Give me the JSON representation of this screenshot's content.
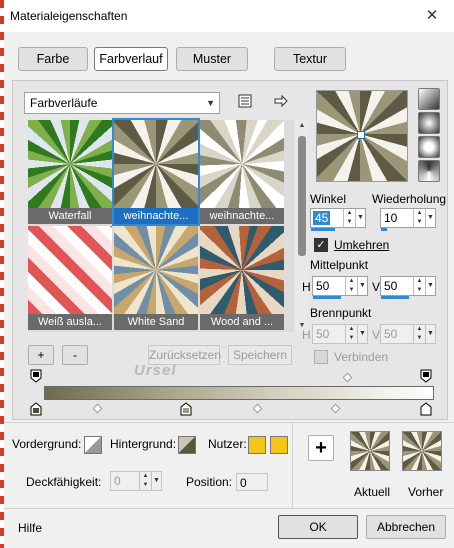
{
  "window": {
    "title": "Materialeigenschaften",
    "close_glyph": "✕"
  },
  "tabs": [
    "Farbe",
    "Farbverlauf",
    "Muster",
    "Textur"
  ],
  "active_tab": "Farbverlauf",
  "gradient_category": "Farbverläufe",
  "gradients": [
    {
      "label": "Waterfall",
      "selected": false
    },
    {
      "label": "weihnachte...",
      "selected": true
    },
    {
      "label": "weihnachte...",
      "selected": false
    },
    {
      "label": "Weiß ausla...",
      "selected": false
    },
    {
      "label": "White Sand",
      "selected": false
    },
    {
      "label": "Wood and ...",
      "selected": false
    }
  ],
  "angle": {
    "label": "Winkel",
    "value": "45"
  },
  "repeat": {
    "label": "Wiederholung",
    "value": "10"
  },
  "invert": {
    "label": "Umkehren",
    "checked": true
  },
  "center": {
    "label": "Mittelpunkt",
    "h_label": "H",
    "h_value": "50",
    "v_label": "V",
    "v_value": "50"
  },
  "focus": {
    "label": "Brennpunkt",
    "h_label": "H",
    "h_value": "50",
    "v_label": "V",
    "v_value": "50"
  },
  "link": {
    "label": "Verbinden",
    "checked": false
  },
  "buttons": {
    "add": "+",
    "remove": "-",
    "reset": "Zurücksetzen",
    "save": "Speichern",
    "ok": "OK",
    "cancel": "Abbrechen",
    "help": "Hilfe",
    "add_to_swatch": "+"
  },
  "watermark": "Ursel",
  "colors": {
    "foreground_label": "Vordergrund:",
    "background_label": "Hintergrund:",
    "user_label": "Nutzer:",
    "user_color_1": "#f5c518",
    "user_color_2": "#f5c518"
  },
  "opacity": {
    "label": "Deckfähigkeit:",
    "value": "0"
  },
  "position": {
    "label": "Position:",
    "value": "0"
  },
  "swatches": {
    "current_label": "Aktuell",
    "previous_label": "Vorher"
  },
  "icons": {
    "close": "close-icon",
    "library": "gradient-library-icon",
    "export": "arrow-right-icon"
  }
}
